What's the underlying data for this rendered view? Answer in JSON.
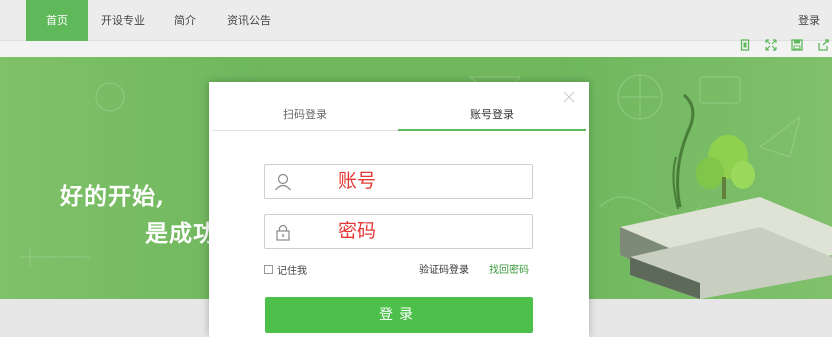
{
  "nav": {
    "items": [
      {
        "label": "首页",
        "active": true
      },
      {
        "label": "开设专业",
        "active": false
      },
      {
        "label": "简介",
        "active": false
      },
      {
        "label": "资讯公告",
        "active": false
      }
    ],
    "login": "登录"
  },
  "toolbar": {
    "icons": [
      "page-icon",
      "expand-icon",
      "save-icon",
      "share-icon"
    ],
    "color": "#5fb85a"
  },
  "banner": {
    "slogan_line1": "好的开始,",
    "slogan_line2": "是成功"
  },
  "login_panel": {
    "tabs": [
      {
        "label": "扫码登录",
        "active": false
      },
      {
        "label": "账号登录",
        "active": true
      }
    ],
    "account_placeholder": "账号",
    "password_placeholder": "密码",
    "remember_label": "记住我",
    "vcode_login": "验证码登录",
    "forgot_password": "找回密码",
    "submit_label": "登录"
  },
  "colors": {
    "accent": "#5fb85a",
    "button": "#4cc04a",
    "hint_red": "#e53935"
  }
}
